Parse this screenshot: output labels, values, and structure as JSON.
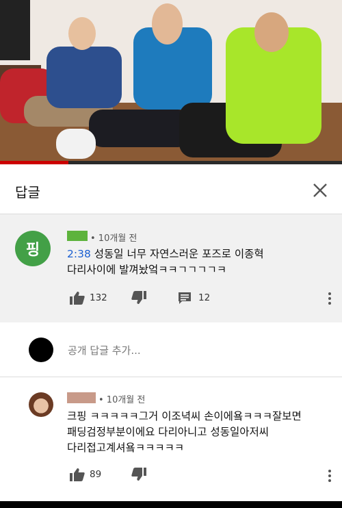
{
  "video": {
    "progress_fraction": 0.2
  },
  "header": {
    "title": "답글",
    "close_icon": "close-icon"
  },
  "main_comment": {
    "avatar_letter": "핑",
    "avatar_color": "#43a047",
    "time": "• 10개월 전",
    "timestamp_link": "2:38",
    "text_rest": " 성동일 너무 자연스러운 포즈로 이종혁",
    "text_line2": "다리사이에 발껴놨엌ㅋㅋㄱㄱㄱㄱㅋ",
    "likes": "132",
    "replies": "12"
  },
  "add_reply": {
    "placeholder": "공개 답글 추가..."
  },
  "reply": {
    "time": "• 10개월 전",
    "lines": [
      "크핑 ㅋㅋㅋㅋㅋ그거 이조녁씨 손이에욬ㅋㅋㅋ잘보면",
      "패딩검정부분이에요 다리아니고 성동일아저씨",
      "다리접고계셔욬ㅋㅋㅋㅋㅋ"
    ],
    "likes": "89"
  }
}
